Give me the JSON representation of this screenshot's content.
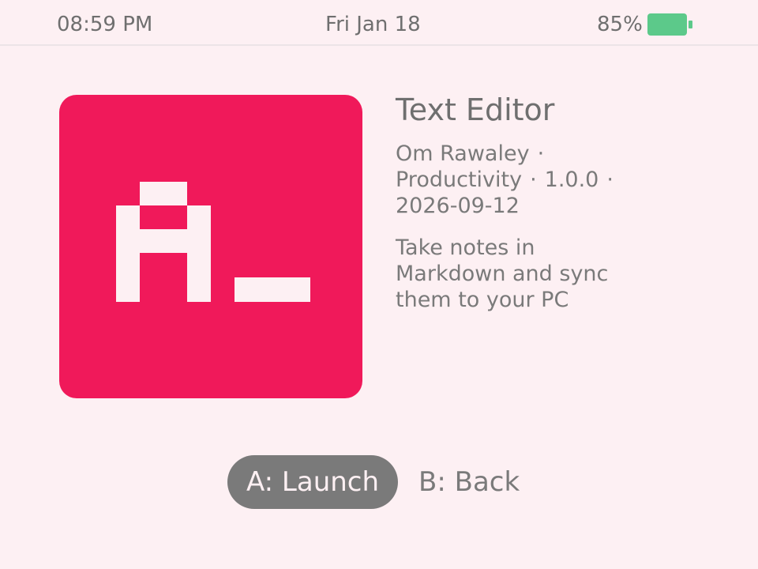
{
  "status_bar": {
    "time": "08:59 PM",
    "date": "Fri Jan 18",
    "battery_percent": "85%",
    "battery_level": 0.85,
    "battery_color": "#5cc98a"
  },
  "app": {
    "title": "Text Editor",
    "icon_color": "#f0195a",
    "icon_glyph_color": "#fdf0f3",
    "author": "Om Rawaley",
    "category": "Productivity",
    "version": "1.0.0",
    "date": "2026-09-12",
    "separator": "·",
    "description_lines": [
      "Take notes in",
      "Markdown and sync",
      "them to your PC"
    ]
  },
  "actions": {
    "launch_label": "A: Launch",
    "back_label": "B: Back"
  }
}
